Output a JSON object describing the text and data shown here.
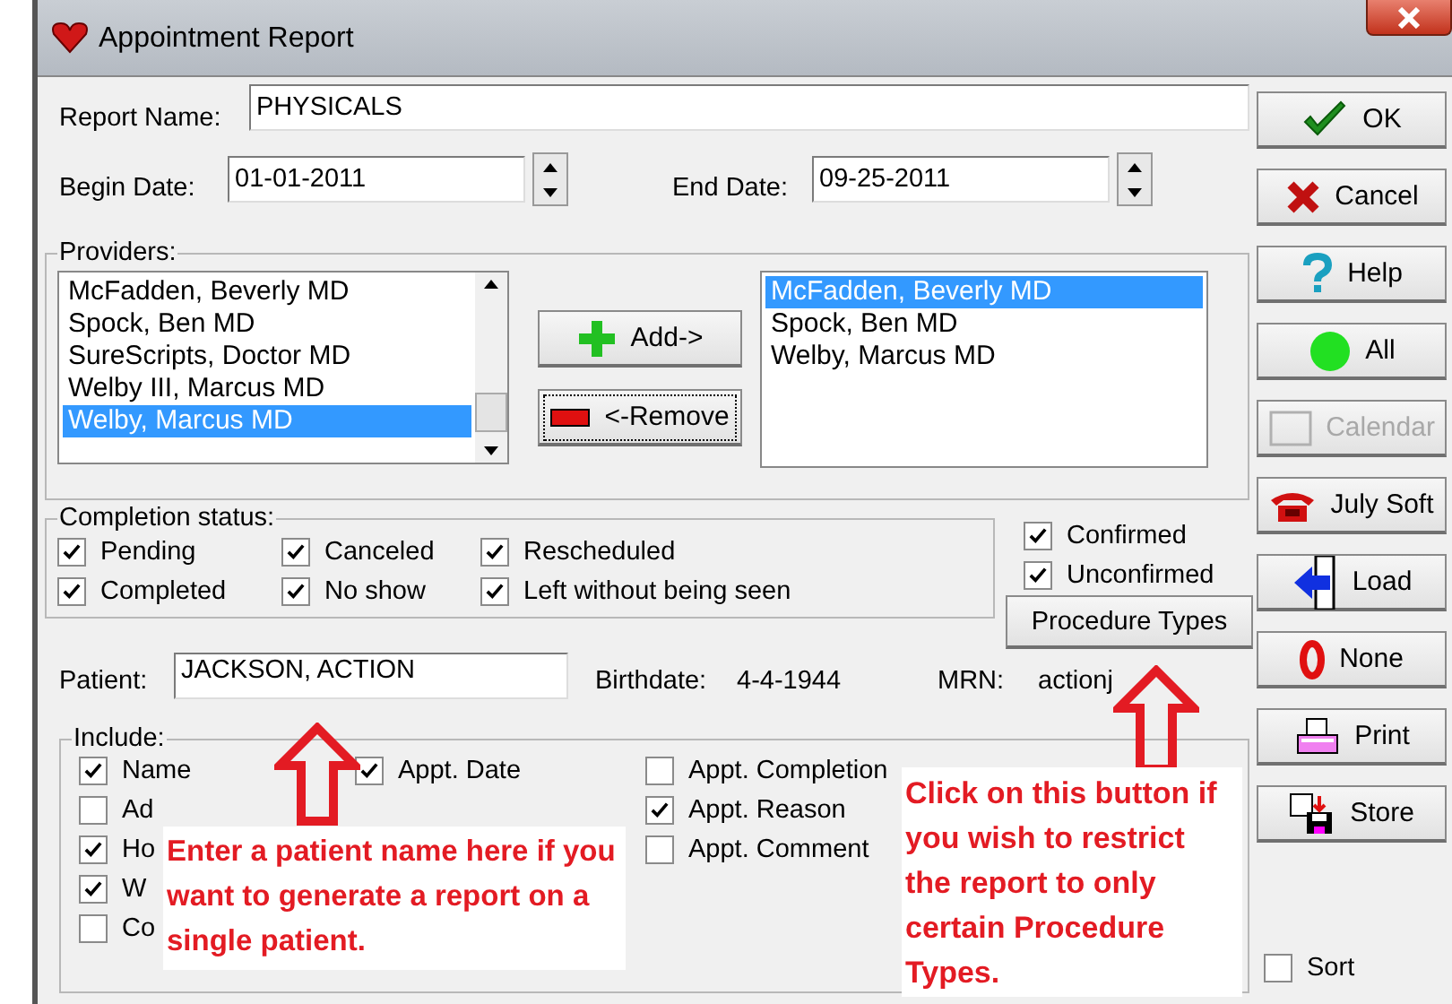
{
  "window": {
    "title": "Appointment Report"
  },
  "report_name": {
    "label": "Report Name:",
    "value": "PHYSICALS"
  },
  "begin_date": {
    "label": "Begin Date:",
    "value": "01-01-2011"
  },
  "end_date": {
    "label": "End Date:",
    "value": "09-25-2011"
  },
  "providers": {
    "label": "Providers:",
    "available": [
      {
        "name": "McFadden, Beverly MD",
        "selected": false
      },
      {
        "name": "Spock, Ben MD",
        "selected": false
      },
      {
        "name": "SureScripts, Doctor MD",
        "selected": false
      },
      {
        "name": "Welby III, Marcus MD",
        "selected": false
      },
      {
        "name": "Welby, Marcus MD",
        "selected": true
      }
    ],
    "chosen": [
      {
        "name": "McFadden, Beverly MD",
        "selected": true
      },
      {
        "name": "Spock, Ben MD",
        "selected": false
      },
      {
        "name": "Welby, Marcus MD",
        "selected": false
      }
    ],
    "add_button": "Add->",
    "remove_button": "<-Remove"
  },
  "completion_status": {
    "label": "Completion status:",
    "options": [
      {
        "label": "Pending",
        "checked": true
      },
      {
        "label": "Canceled",
        "checked": true
      },
      {
        "label": "Rescheduled",
        "checked": true
      },
      {
        "label": "Completed",
        "checked": true
      },
      {
        "label": "No show",
        "checked": true
      },
      {
        "label": "Left without being seen",
        "checked": true
      }
    ]
  },
  "confirmation": [
    {
      "label": "Confirmed",
      "checked": true
    },
    {
      "label": "Unconfirmed",
      "checked": true
    }
  ],
  "procedure_types_button": "Procedure Types",
  "patient": {
    "label": "Patient:",
    "value": "JACKSON, ACTION",
    "birthdate_label": "Birthdate:",
    "birthdate": "4-4-1944",
    "mrn_label": "MRN:",
    "mrn": "actionj"
  },
  "include": {
    "label": "Include:",
    "columns": [
      [
        {
          "label": "Name",
          "checked": true
        },
        {
          "label": "Ad",
          "checked": false
        },
        {
          "label": "Ho",
          "checked": true
        },
        {
          "label": "W",
          "checked": true
        },
        {
          "label": "Co",
          "checked": false
        }
      ],
      [
        {
          "label": "Appt. Date",
          "checked": true
        }
      ],
      [
        {
          "label": "Appt. Completion",
          "checked": false
        },
        {
          "label": "Appt. Reason",
          "checked": true
        },
        {
          "label": "Appt. Comment",
          "checked": false
        }
      ]
    ]
  },
  "side_buttons": [
    {
      "label": "OK",
      "kind": "ok",
      "disabled": false
    },
    {
      "label": "Cancel",
      "kind": "cancel",
      "disabled": false
    },
    {
      "label": "Help",
      "kind": "help",
      "disabled": false
    },
    {
      "label": "All",
      "kind": "all",
      "disabled": false
    },
    {
      "label": "Calendar",
      "kind": "calendar",
      "disabled": true
    },
    {
      "label": "July Soft",
      "kind": "phone",
      "disabled": false
    },
    {
      "label": "Load",
      "kind": "load",
      "disabled": false
    },
    {
      "label": "None",
      "kind": "none",
      "disabled": false
    },
    {
      "label": "Print",
      "kind": "print",
      "disabled": false
    },
    {
      "label": "Store",
      "kind": "store",
      "disabled": false
    }
  ],
  "sort": {
    "label": "Sort",
    "checked": false
  },
  "annotations": [
    {
      "text": "Enter a patient name here if you want to generate a report on a single patient."
    },
    {
      "text": "Click on this button if you wish to restrict the report to only certain Procedure Types."
    }
  ]
}
